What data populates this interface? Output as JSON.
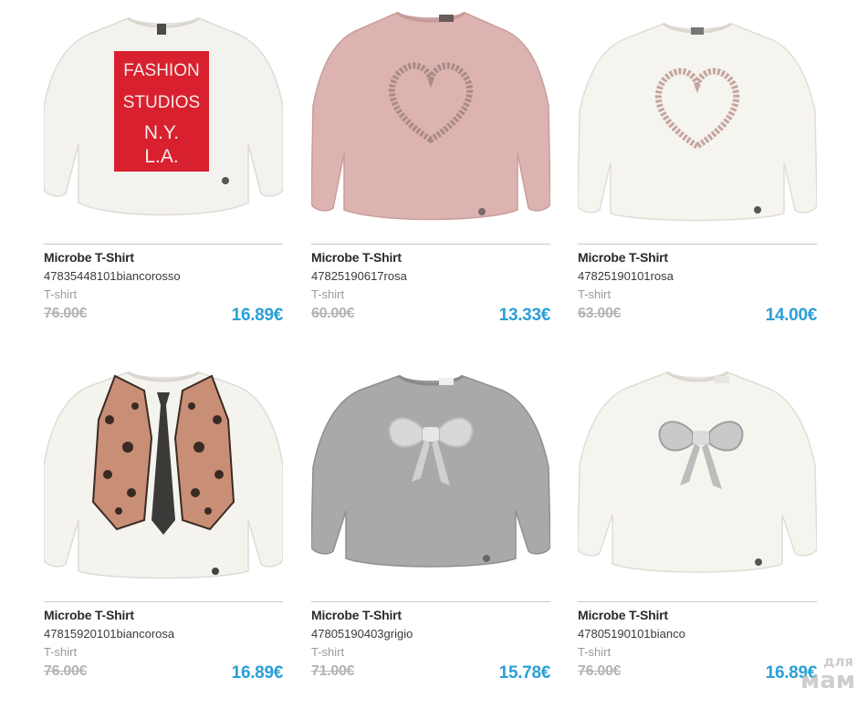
{
  "products": [
    {
      "name": "Microbe T-Shirt",
      "code": "47835448101biancorosso",
      "category": "T-shirt",
      "old_price": "76.00€",
      "price": "16.89€",
      "image_icon": "white-shirt-fashion-studios-print-icon",
      "print_text": [
        "FASHION",
        "STUDIOS",
        "N.Y.",
        "L.A."
      ],
      "colors": {
        "body": "#f4f2ee",
        "print": "#d8202e"
      }
    },
    {
      "name": "Microbe T-Shirt",
      "code": "47825190617rosa",
      "category": "T-shirt",
      "old_price": "60.00€",
      "price": "13.33€",
      "image_icon": "pink-shirt-sequin-heart-icon",
      "colors": {
        "body": "#dcb3b1",
        "print": "#a98b86"
      }
    },
    {
      "name": "Microbe T-Shirt",
      "code": "47825190101rosa",
      "category": "T-shirt",
      "old_price": "63.00€",
      "price": "14.00€",
      "image_icon": "white-shirt-sequin-heart-icon",
      "colors": {
        "body": "#f6f4ef",
        "print": "#c7a59f"
      }
    },
    {
      "name": "Microbe T-Shirt",
      "code": "47815920101biancorosa",
      "category": "T-shirt",
      "old_price": "76.00€",
      "price": "16.89€",
      "image_icon": "white-shirt-leopard-vest-tie-icon",
      "colors": {
        "body": "#f5f3ee",
        "print": "#c98e76"
      }
    },
    {
      "name": "Microbe T-Shirt",
      "code": "47805190403grigio",
      "category": "T-shirt",
      "old_price": "71.00€",
      "price": "15.78€",
      "image_icon": "grey-shirt-sequin-bow-icon",
      "colors": {
        "body": "#a9a9a9",
        "print": "#d8d8d8"
      }
    },
    {
      "name": "Microbe T-Shirt",
      "code": "47805190101bianco",
      "category": "T-shirt",
      "old_price": "76.00€",
      "price": "16.89€",
      "image_icon": "white-shirt-sequin-bow-icon",
      "colors": {
        "body": "#f6f4ef",
        "print": "#a9a9a9"
      }
    }
  ],
  "watermark": {
    "line1": "для",
    "line2": "мам"
  },
  "colors": {
    "price": "#2a9fd8",
    "old_price": "#b3b3b3",
    "rule": "#c9c9c9"
  }
}
